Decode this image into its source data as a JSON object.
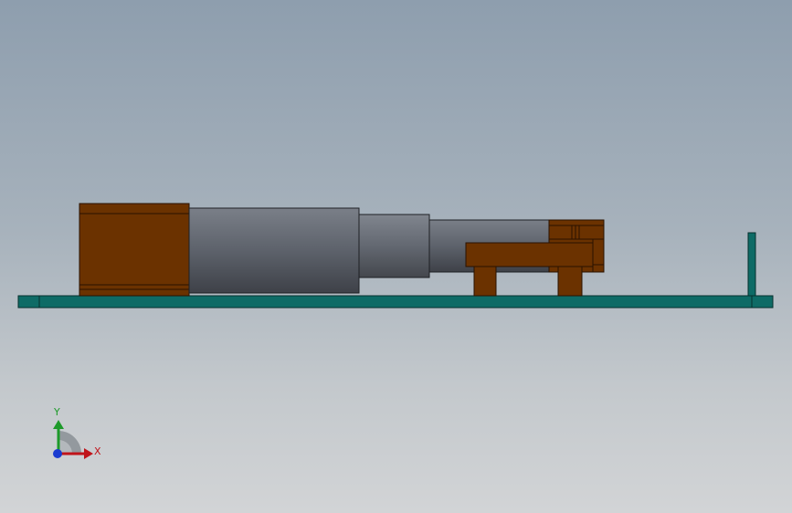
{
  "viewport": {
    "background_top": "#8e9eae",
    "background_bottom": "#d2d4d6"
  },
  "model": {
    "colors": {
      "base_plate": "#0e6b66",
      "base_plate_edge": "#06302e",
      "brown_part": "#6b3200",
      "brown_edge": "#2a1200",
      "gray_part": "#5f6470",
      "gray_edge": "#1e2024"
    }
  },
  "triad": {
    "x_label": "X",
    "y_label": "Y",
    "x_color": "#c0141a",
    "y_color": "#1d9a2a",
    "z_color": "#1a3bd0"
  }
}
